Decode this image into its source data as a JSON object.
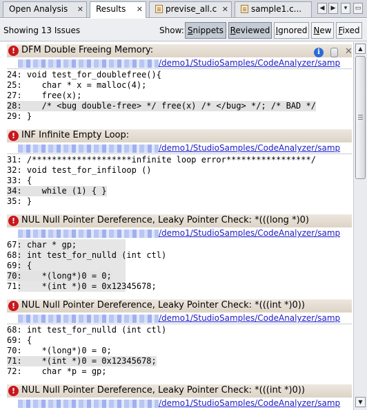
{
  "tabs": [
    {
      "label": "Open Analysis",
      "active": false,
      "file_icon": false
    },
    {
      "label": "Results",
      "active": true,
      "file_icon": false
    },
    {
      "label": "previse_all.c",
      "active": false,
      "file_icon": true
    },
    {
      "label": "sample1.c...",
      "active": false,
      "file_icon": true
    }
  ],
  "tab_nav": {
    "left": "◀",
    "right": "▶",
    "menu": "▾"
  },
  "toolbar": {
    "showing": "Showing 13 Issues",
    "show_label": "Show:",
    "filters": [
      {
        "label": "Snippets",
        "mnemonic": "S",
        "rest": "nippets",
        "on": true
      },
      {
        "label": "Reviewed",
        "mnemonic": "R",
        "rest": "eviewed",
        "on": true
      },
      {
        "label": "Ignored",
        "mnemonic": "I",
        "rest": "gnored",
        "on": false
      },
      {
        "label": "New",
        "mnemonic": "N",
        "rest": "ew",
        "on": false
      },
      {
        "label": "Fixed",
        "mnemonic": "F",
        "rest": "ixed",
        "on": false
      }
    ]
  },
  "path_suffix": "/demo1/StudioSamples/CodeAnalyzer/samp",
  "issues": [
    {
      "title": "DFM Double Freeing Memory:",
      "lines": [
        {
          "text": "24: void test_for_doublefree(){",
          "hl": false
        },
        {
          "text": "25:    char * x = malloc(4);",
          "hl": false
        },
        {
          "text": "27:    free(x);",
          "hl": false
        },
        {
          "text": "28:    /* <bug double-free> */ free(x) /* </bug> */; /* BAD */",
          "hl": true
        },
        {
          "text": "29: }",
          "hl": false
        }
      ]
    },
    {
      "title": "INF Infinite Empty Loop:",
      "lines": [
        {
          "text": "31: /********************infinite loop error*****************/",
          "hl": false
        },
        {
          "text": "32: void test_for_infiloop ()",
          "hl": false
        },
        {
          "text": "33: {",
          "hl": false
        },
        {
          "text": "34:    while (1) { }",
          "hl": true
        },
        {
          "text": "35: }",
          "hl": false
        }
      ]
    },
    {
      "title": "NUL Null Pointer Dereference, Leaky Pointer Check: *(((long *)0)",
      "lines": [
        {
          "text": "67: char * gp;",
          "hl": false
        },
        {
          "text": "68: int test_for_nulld (int ctl)",
          "hl": false
        },
        {
          "text": "69: {",
          "hl": false
        },
        {
          "text": "70:    *(long*)0 = 0;",
          "hl": true
        },
        {
          "text": "71:    *(int *)0 = 0x12345678;",
          "hl": false
        }
      ]
    },
    {
      "title": "NUL Null Pointer Dereference, Leaky Pointer Check: *(((int *)0))",
      "lines": [
        {
          "text": "68: int test_for_nulld (int ctl)",
          "hl": false
        },
        {
          "text": "69: {",
          "hl": false
        },
        {
          "text": "70:    *(long*)0 = 0;",
          "hl": false
        },
        {
          "text": "71:    *(int *)0 = 0x12345678;",
          "hl": true
        },
        {
          "text": "72:    char *p = gp;",
          "hl": false
        }
      ]
    },
    {
      "title": "NUL Null Pointer Dereference, Leaky Pointer Check: *(((int *)0))",
      "lines": []
    }
  ],
  "icons": {
    "error": "error-icon",
    "info": "info-icon",
    "trash": "trash-icon",
    "close": "close-icon"
  },
  "colors": {
    "error": "#c9161c",
    "link": "#1a1ac8",
    "header_bg": "#e4ddd3",
    "highlight": "#e3e3e3"
  }
}
